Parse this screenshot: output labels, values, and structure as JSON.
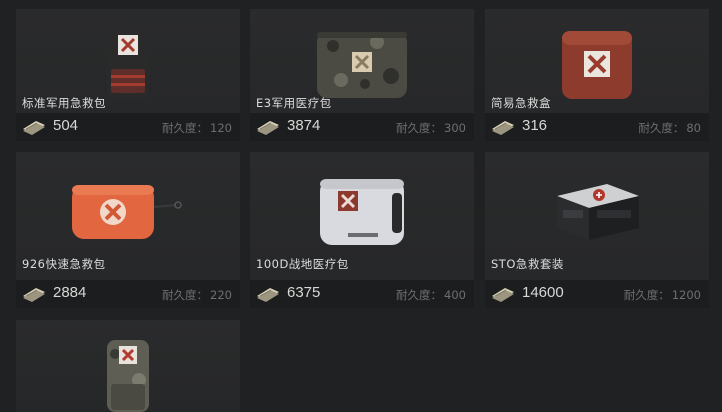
{
  "items": [
    {
      "name": "标准军用急救包",
      "price": "504",
      "durability_label": "耐久度：",
      "durability": "120",
      "icon": "military-backpack-icon"
    },
    {
      "name": "E3军用医疗包",
      "price": "3874",
      "durability_label": "耐久度：",
      "durability": "300",
      "icon": "camo-medical-pouch-icon"
    },
    {
      "name": "简易急救盒",
      "price": "316",
      "durability_label": "耐久度：",
      "durability": "80",
      "icon": "red-first-aid-box-icon"
    },
    {
      "name": "926快速急救包",
      "price": "2884",
      "durability_label": "耐久度：",
      "durability": "220",
      "icon": "orange-first-aid-pouch-icon"
    },
    {
      "name": "100D战地医疗包",
      "price": "6375",
      "durability_label": "耐久度：",
      "durability": "400",
      "icon": "white-medical-bag-icon"
    },
    {
      "name": "STO急救套装",
      "price": "14600",
      "durability_label": "耐久度：",
      "durability": "1200",
      "icon": "black-medical-case-icon"
    },
    {
      "name": "",
      "price": "",
      "durability_label": "",
      "durability": "",
      "icon": "camo-medical-backpack-icon"
    }
  ],
  "currency_icon": "cash-stack-icon"
}
